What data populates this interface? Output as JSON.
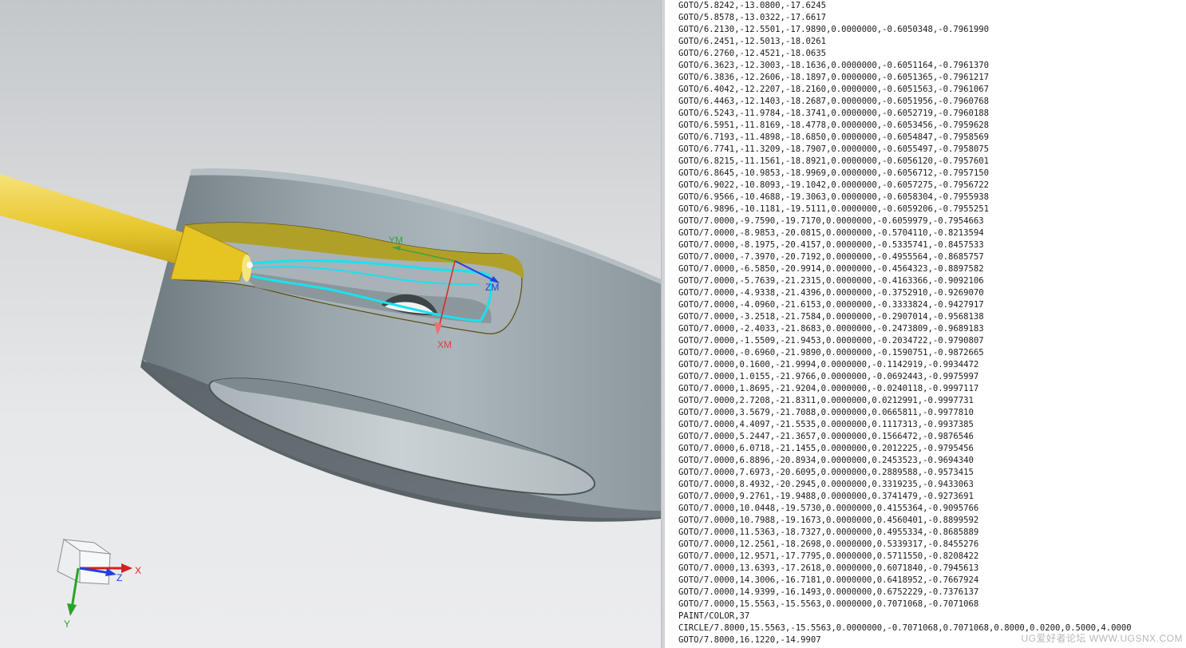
{
  "viewport": {
    "csys_labels": {
      "ym": "YM",
      "zm": "ZM",
      "xm": "XM"
    },
    "triad_labels": {
      "x": "X",
      "y": "Y",
      "z": "Z"
    },
    "colors": {
      "part_body": "#8f9ca3",
      "tool": "#e8c830",
      "toolpath": "#19e2f0",
      "slot_edge": "#b0a028",
      "axis_x": "#e02424",
      "axis_y": "#2aa22a",
      "axis_z": "#2340e0"
    }
  },
  "cl_output": {
    "lines": [
      "GOTO/5.8242,-13.0800,-17.6245",
      "GOTO/5.8578,-13.0322,-17.6617",
      "GOTO/6.2130,-12.5501,-17.9890,0.0000000,-0.6050348,-0.7961990",
      "GOTO/6.2451,-12.5013,-18.0261",
      "GOTO/6.2760,-12.4521,-18.0635",
      "GOTO/6.3623,-12.3003,-18.1636,0.0000000,-0.6051164,-0.7961370",
      "GOTO/6.3836,-12.2606,-18.1897,0.0000000,-0.6051365,-0.7961217",
      "GOTO/6.4042,-12.2207,-18.2160,0.0000000,-0.6051563,-0.7961067",
      "GOTO/6.4463,-12.1403,-18.2687,0.0000000,-0.6051956,-0.7960768",
      "GOTO/6.5243,-11.9784,-18.3741,0.0000000,-0.6052719,-0.7960188",
      "GOTO/6.5951,-11.8169,-18.4778,0.0000000,-0.6053456,-0.7959628",
      "GOTO/6.7193,-11.4898,-18.6850,0.0000000,-0.6054847,-0.7958569",
      "GOTO/6.7741,-11.3209,-18.7907,0.0000000,-0.6055497,-0.7958075",
      "GOTO/6.8215,-11.1561,-18.8921,0.0000000,-0.6056120,-0.7957601",
      "GOTO/6.8645,-10.9853,-18.9969,0.0000000,-0.6056712,-0.7957150",
      "GOTO/6.9022,-10.8093,-19.1042,0.0000000,-0.6057275,-0.7956722",
      "GOTO/6.9566,-10.4688,-19.3063,0.0000000,-0.6058304,-0.7955938",
      "GOTO/6.9896,-10.1181,-19.5111,0.0000000,-0.6059206,-0.7955251",
      "GOTO/7.0000,-9.7590,-19.7170,0.0000000,-0.6059979,-0.7954663",
      "GOTO/7.0000,-8.9853,-20.0815,0.0000000,-0.5704110,-0.8213594",
      "GOTO/7.0000,-8.1975,-20.4157,0.0000000,-0.5335741,-0.8457533",
      "GOTO/7.0000,-7.3970,-20.7192,0.0000000,-0.4955564,-0.8685757",
      "GOTO/7.0000,-6.5850,-20.9914,0.0000000,-0.4564323,-0.8897582",
      "GOTO/7.0000,-5.7639,-21.2315,0.0000000,-0.4163366,-0.9092106",
      "GOTO/7.0000,-4.9338,-21.4396,0.0000000,-0.3752910,-0.9269070",
      "GOTO/7.0000,-4.0960,-21.6153,0.0000000,-0.3333824,-0.9427917",
      "GOTO/7.0000,-3.2518,-21.7584,0.0000000,-0.2907014,-0.9568138",
      "GOTO/7.0000,-2.4033,-21.8683,0.0000000,-0.2473809,-0.9689183",
      "GOTO/7.0000,-1.5509,-21.9453,0.0000000,-0.2034722,-0.9790807",
      "GOTO/7.0000,-0.6960,-21.9890,0.0000000,-0.1590751,-0.9872665",
      "GOTO/7.0000,0.1600,-21.9994,0.0000000,-0.1142919,-0.9934472",
      "GOTO/7.0000,1.0155,-21.9766,0.0000000,-0.0692443,-0.9975997",
      "GOTO/7.0000,1.8695,-21.9204,0.0000000,-0.0240118,-0.9997117",
      "GOTO/7.0000,2.7208,-21.8311,0.0000000,0.0212991,-0.9997731",
      "GOTO/7.0000,3.5679,-21.7088,0.0000000,0.0665811,-0.9977810",
      "GOTO/7.0000,4.4097,-21.5535,0.0000000,0.1117313,-0.9937385",
      "GOTO/7.0000,5.2447,-21.3657,0.0000000,0.1566472,-0.9876546",
      "GOTO/7.0000,6.0718,-21.1455,0.0000000,0.2012225,-0.9795456",
      "GOTO/7.0000,6.8896,-20.8934,0.0000000,0.2453523,-0.9694340",
      "GOTO/7.0000,7.6973,-20.6095,0.0000000,0.2889588,-0.9573415",
      "GOTO/7.0000,8.4932,-20.2945,0.0000000,0.3319235,-0.9433063",
      "GOTO/7.0000,9.2761,-19.9488,0.0000000,0.3741479,-0.9273691",
      "GOTO/7.0000,10.0448,-19.5730,0.0000000,0.4155364,-0.9095766",
      "GOTO/7.0000,10.7988,-19.1673,0.0000000,0.4560401,-0.8899592",
      "GOTO/7.0000,11.5363,-18.7327,0.0000000,0.4955334,-0.8685889",
      "GOTO/7.0000,12.2561,-18.2698,0.0000000,0.5339317,-0.8455276",
      "GOTO/7.0000,12.9571,-17.7795,0.0000000,0.5711550,-0.8208422",
      "GOTO/7.0000,13.6393,-17.2618,0.0000000,0.6071840,-0.7945613",
      "GOTO/7.0000,14.3006,-16.7181,0.0000000,0.6418952,-0.7667924",
      "GOTO/7.0000,14.9399,-16.1493,0.0000000,0.6752229,-0.7376137",
      "GOTO/7.0000,15.5563,-15.5563,0.0000000,0.7071068,-0.7071068",
      "PAINT/COLOR,37",
      "CIRCLE/7.8000,15.5563,-15.5563,0.0000000,-0.7071068,0.7071068,0.8000,0.0200,0.5000,4.0000",
      "GOTO/7.8000,16.1220,-14.9907"
    ]
  },
  "watermark": "UG爱好者论坛 WWW.UGSNX.COM"
}
